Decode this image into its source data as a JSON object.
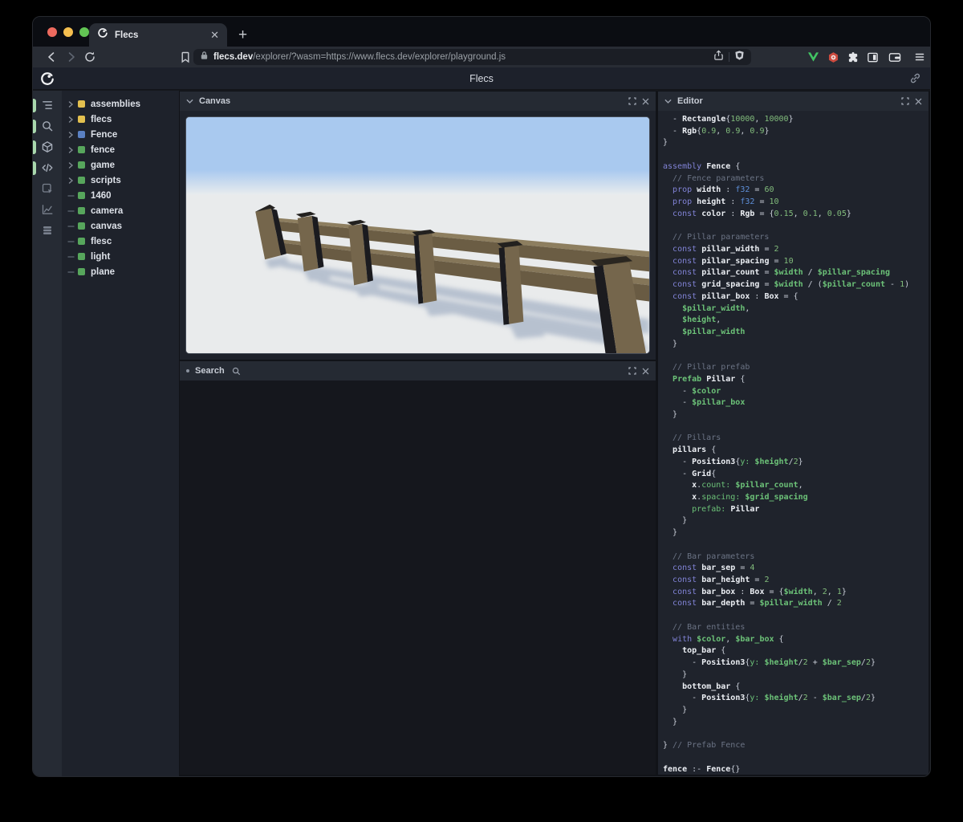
{
  "browser": {
    "tab": {
      "title": "Flecs",
      "close_icon": "close-icon",
      "new_tab_icon": "plus-icon"
    },
    "traffic_lights": {
      "close": "#ed6a5e",
      "minimize": "#f5bf4f",
      "zoom": "#62c554"
    },
    "nav_icons": [
      "back-icon",
      "forward-icon",
      "reload-icon",
      "bookmark-icon"
    ],
    "url": {
      "lock_icon": "lock-icon",
      "domain": "flecs.dev",
      "path": "/explorer/?wasm=https://www.flecs.dev/explorer/playground.js",
      "trailing_icons": [
        "share-icon",
        "brave-shield-icon"
      ]
    },
    "ext_icons": [
      "vue-devtools-icon",
      "red-badge-icon",
      "extensions-puzzle-icon",
      "sidebar-icon",
      "wallet-icon",
      "menu-icon"
    ]
  },
  "header": {
    "title": "Flecs",
    "logo": "flecs-logo",
    "link_icon": "link-icon"
  },
  "sidebar": {
    "tools": [
      {
        "name": "tree-view",
        "active": true
      },
      {
        "name": "search",
        "active": true
      },
      {
        "name": "canvas",
        "active": true
      },
      {
        "name": "code",
        "active": true
      },
      {
        "name": "inspector",
        "active": false
      },
      {
        "name": "stats",
        "active": false
      },
      {
        "name": "entities-stack",
        "active": false
      }
    ],
    "active_pill_color": "#a9d8ad",
    "tree": [
      {
        "label": "assemblies",
        "color": "#e3c04f",
        "expandable": true
      },
      {
        "label": "flecs",
        "color": "#e3c04f",
        "expandable": true
      },
      {
        "label": "Fence",
        "color": "#5a80c2",
        "expandable": true
      },
      {
        "label": "fence",
        "color": "#57a65c",
        "expandable": true
      },
      {
        "label": "game",
        "color": "#57a65c",
        "expandable": true
      },
      {
        "label": "scripts",
        "color": "#57a65c",
        "expandable": true
      },
      {
        "label": "1460",
        "color": "#57a65c",
        "expandable": false
      },
      {
        "label": "camera",
        "color": "#57a65c",
        "expandable": false
      },
      {
        "label": "canvas",
        "color": "#57a65c",
        "expandable": false
      },
      {
        "label": "flesc",
        "color": "#57a65c",
        "expandable": false
      },
      {
        "label": "light",
        "color": "#57a65c",
        "expandable": false
      },
      {
        "label": "plane",
        "color": "#57a65c",
        "expandable": false
      }
    ]
  },
  "panels": {
    "canvas": {
      "title": "Canvas"
    },
    "search": {
      "title": "Search"
    },
    "editor": {
      "title": "Editor",
      "syntax_colors": {
        "keyword": "#8183d6",
        "entity": "#eceff4",
        "type": "#5e8fd8",
        "number": "#82bc7c",
        "variable": "#6cc278",
        "comment": "#6b7384",
        "plain": "#c9ced8"
      },
      "code": [
        [
          [
            "p",
            "  - "
          ],
          [
            "e",
            "Rectangle"
          ],
          [
            "p",
            "{"
          ],
          [
            "n",
            "10000"
          ],
          [
            "p",
            ", "
          ],
          [
            "n",
            "10000"
          ],
          [
            "p",
            "}"
          ]
        ],
        [
          [
            "p",
            "  - "
          ],
          [
            "e",
            "Rgb"
          ],
          [
            "p",
            "{"
          ],
          [
            "n",
            "0.9"
          ],
          [
            "p",
            ", "
          ],
          [
            "n",
            "0.9"
          ],
          [
            "p",
            ", "
          ],
          [
            "n",
            "0.9"
          ],
          [
            "p",
            "}"
          ]
        ],
        [
          [
            "p",
            "}"
          ]
        ],
        [],
        [
          [
            "k",
            "assembly"
          ],
          [
            "p",
            " "
          ],
          [
            "e",
            "Fence"
          ],
          [
            "p",
            " {"
          ]
        ],
        [
          [
            "c",
            "  // Fence parameters"
          ]
        ],
        [
          [
            "p",
            "  "
          ],
          [
            "k",
            "prop"
          ],
          [
            "p",
            " "
          ],
          [
            "e",
            "width"
          ],
          [
            "p",
            " : "
          ],
          [
            "t",
            "f32"
          ],
          [
            "p",
            " = "
          ],
          [
            "n",
            "60"
          ]
        ],
        [
          [
            "p",
            "  "
          ],
          [
            "k",
            "prop"
          ],
          [
            "p",
            " "
          ],
          [
            "e",
            "height"
          ],
          [
            "p",
            " : "
          ],
          [
            "t",
            "f32"
          ],
          [
            "p",
            " = "
          ],
          [
            "n",
            "10"
          ]
        ],
        [
          [
            "p",
            "  "
          ],
          [
            "k",
            "const"
          ],
          [
            "p",
            " "
          ],
          [
            "e",
            "color"
          ],
          [
            "p",
            " : "
          ],
          [
            "e",
            "Rgb"
          ],
          [
            "p",
            " = {"
          ],
          [
            "n",
            "0.15"
          ],
          [
            "p",
            ", "
          ],
          [
            "n",
            "0.1"
          ],
          [
            "p",
            ", "
          ],
          [
            "n",
            "0.05"
          ],
          [
            "p",
            "}"
          ]
        ],
        [],
        [
          [
            "c",
            "  // Pillar parameters"
          ]
        ],
        [
          [
            "p",
            "  "
          ],
          [
            "k",
            "const"
          ],
          [
            "p",
            " "
          ],
          [
            "e",
            "pillar_width"
          ],
          [
            "p",
            " = "
          ],
          [
            "n",
            "2"
          ]
        ],
        [
          [
            "p",
            "  "
          ],
          [
            "k",
            "const"
          ],
          [
            "p",
            " "
          ],
          [
            "e",
            "pillar_spacing"
          ],
          [
            "p",
            " = "
          ],
          [
            "n",
            "10"
          ]
        ],
        [
          [
            "p",
            "  "
          ],
          [
            "k",
            "const"
          ],
          [
            "p",
            " "
          ],
          [
            "e",
            "pillar_count"
          ],
          [
            "p",
            " = "
          ],
          [
            "v",
            "$width"
          ],
          [
            "p",
            " / "
          ],
          [
            "v",
            "$pillar_spacing"
          ]
        ],
        [
          [
            "p",
            "  "
          ],
          [
            "k",
            "const"
          ],
          [
            "p",
            " "
          ],
          [
            "e",
            "grid_spacing"
          ],
          [
            "p",
            " = "
          ],
          [
            "v",
            "$width"
          ],
          [
            "p",
            " / ("
          ],
          [
            "v",
            "$pillar_count"
          ],
          [
            "p",
            " - "
          ],
          [
            "n",
            "1"
          ],
          [
            "p",
            ")"
          ]
        ],
        [
          [
            "p",
            "  "
          ],
          [
            "k",
            "const"
          ],
          [
            "p",
            " "
          ],
          [
            "e",
            "pillar_box"
          ],
          [
            "p",
            " : "
          ],
          [
            "e",
            "Box"
          ],
          [
            "p",
            " = {"
          ]
        ],
        [
          [
            "p",
            "    "
          ],
          [
            "v",
            "$pillar_width"
          ],
          [
            "p",
            ","
          ]
        ],
        [
          [
            "p",
            "    "
          ],
          [
            "v",
            "$height"
          ],
          [
            "p",
            ","
          ]
        ],
        [
          [
            "p",
            "    "
          ],
          [
            "v",
            "$pillar_width"
          ]
        ],
        [
          [
            "p",
            "  }"
          ]
        ],
        [],
        [
          [
            "c",
            "  // Pillar prefab"
          ]
        ],
        [
          [
            "p",
            "  "
          ],
          [
            "v",
            "Prefab"
          ],
          [
            "p",
            " "
          ],
          [
            "e",
            "Pillar"
          ],
          [
            "p",
            " {"
          ]
        ],
        [
          [
            "p",
            "    - "
          ],
          [
            "v",
            "$color"
          ]
        ],
        [
          [
            "p",
            "    - "
          ],
          [
            "v",
            "$pillar_box"
          ]
        ],
        [
          [
            "p",
            "  }"
          ]
        ],
        [],
        [
          [
            "c",
            "  // Pillars"
          ]
        ],
        [
          [
            "p",
            "  "
          ],
          [
            "e",
            "pillars"
          ],
          [
            "p",
            " {"
          ]
        ],
        [
          [
            "p",
            "    - "
          ],
          [
            "e",
            "Position3"
          ],
          [
            "p",
            "{"
          ],
          [
            "g",
            "y:"
          ],
          [
            "p",
            " "
          ],
          [
            "v",
            "$height"
          ],
          [
            "p",
            "/"
          ],
          [
            "n",
            "2"
          ],
          [
            "p",
            "}"
          ]
        ],
        [
          [
            "p",
            "    - "
          ],
          [
            "e",
            "Grid"
          ],
          [
            "p",
            "{"
          ]
        ],
        [
          [
            "p",
            "      "
          ],
          [
            "e",
            "x"
          ],
          [
            "p",
            "."
          ],
          [
            "g",
            "count:"
          ],
          [
            "p",
            " "
          ],
          [
            "v",
            "$pillar_count"
          ],
          [
            "p",
            ","
          ]
        ],
        [
          [
            "p",
            "      "
          ],
          [
            "e",
            "x"
          ],
          [
            "p",
            "."
          ],
          [
            "g",
            "spacing:"
          ],
          [
            "p",
            " "
          ],
          [
            "v",
            "$grid_spacing"
          ]
        ],
        [
          [
            "p",
            "      "
          ],
          [
            "g",
            "prefab:"
          ],
          [
            "p",
            " "
          ],
          [
            "e",
            "Pillar"
          ]
        ],
        [
          [
            "p",
            "    }"
          ]
        ],
        [
          [
            "p",
            "  }"
          ]
        ],
        [],
        [
          [
            "c",
            "  // Bar parameters"
          ]
        ],
        [
          [
            "p",
            "  "
          ],
          [
            "k",
            "const"
          ],
          [
            "p",
            " "
          ],
          [
            "e",
            "bar_sep"
          ],
          [
            "p",
            " = "
          ],
          [
            "n",
            "4"
          ]
        ],
        [
          [
            "p",
            "  "
          ],
          [
            "k",
            "const"
          ],
          [
            "p",
            " "
          ],
          [
            "e",
            "bar_height"
          ],
          [
            "p",
            " = "
          ],
          [
            "n",
            "2"
          ]
        ],
        [
          [
            "p",
            "  "
          ],
          [
            "k",
            "const"
          ],
          [
            "p",
            " "
          ],
          [
            "e",
            "bar_box"
          ],
          [
            "p",
            " : "
          ],
          [
            "e",
            "Box"
          ],
          [
            "p",
            " = {"
          ],
          [
            "v",
            "$width"
          ],
          [
            "p",
            ", "
          ],
          [
            "n",
            "2"
          ],
          [
            "p",
            ", "
          ],
          [
            "n",
            "1"
          ],
          [
            "p",
            "}"
          ]
        ],
        [
          [
            "p",
            "  "
          ],
          [
            "k",
            "const"
          ],
          [
            "p",
            " "
          ],
          [
            "e",
            "bar_depth"
          ],
          [
            "p",
            " = "
          ],
          [
            "v",
            "$pillar_width"
          ],
          [
            "p",
            " / "
          ],
          [
            "n",
            "2"
          ]
        ],
        [],
        [
          [
            "c",
            "  // Bar entities"
          ]
        ],
        [
          [
            "p",
            "  "
          ],
          [
            "k",
            "with"
          ],
          [
            "p",
            " "
          ],
          [
            "v",
            "$color"
          ],
          [
            "p",
            ", "
          ],
          [
            "v",
            "$bar_box"
          ],
          [
            "p",
            " {"
          ]
        ],
        [
          [
            "p",
            "    "
          ],
          [
            "e",
            "top_bar"
          ],
          [
            "p",
            " {"
          ]
        ],
        [
          [
            "p",
            "      - "
          ],
          [
            "e",
            "Position3"
          ],
          [
            "p",
            "{"
          ],
          [
            "g",
            "y:"
          ],
          [
            "p",
            " "
          ],
          [
            "v",
            "$height"
          ],
          [
            "p",
            "/"
          ],
          [
            "n",
            "2"
          ],
          [
            "p",
            " + "
          ],
          [
            "v",
            "$bar_sep"
          ],
          [
            "p",
            "/"
          ],
          [
            "n",
            "2"
          ],
          [
            "p",
            "}"
          ]
        ],
        [
          [
            "p",
            "    }"
          ]
        ],
        [
          [
            "p",
            "    "
          ],
          [
            "e",
            "bottom_bar"
          ],
          [
            "p",
            " {"
          ]
        ],
        [
          [
            "p",
            "      - "
          ],
          [
            "e",
            "Position3"
          ],
          [
            "p",
            "{"
          ],
          [
            "g",
            "y:"
          ],
          [
            "p",
            " "
          ],
          [
            "v",
            "$height"
          ],
          [
            "p",
            "/"
          ],
          [
            "n",
            "2"
          ],
          [
            "p",
            " - "
          ],
          [
            "v",
            "$bar_sep"
          ],
          [
            "p",
            "/"
          ],
          [
            "n",
            "2"
          ],
          [
            "p",
            "}"
          ]
        ],
        [
          [
            "p",
            "    }"
          ]
        ],
        [
          [
            "p",
            "  }"
          ]
        ],
        [],
        [
          [
            "p",
            "} "
          ],
          [
            "c",
            "// Prefab Fence"
          ]
        ],
        [],
        [
          [
            "e",
            "fence"
          ],
          [
            "p",
            " :- "
          ],
          [
            "e",
            "Fence"
          ],
          [
            "p",
            "{}"
          ]
        ]
      ]
    }
  },
  "scene": {
    "description": "3D render of a wooden fence with pillars and two rails on a flat plane",
    "sky_color": "#a9c9ef",
    "ground_color": "#e9ebec",
    "wood_front": "#6e5f46",
    "wood_top": "#8d7e5f",
    "wood_dark": "#1b1b1f",
    "shadow_color": "#8698b4"
  }
}
